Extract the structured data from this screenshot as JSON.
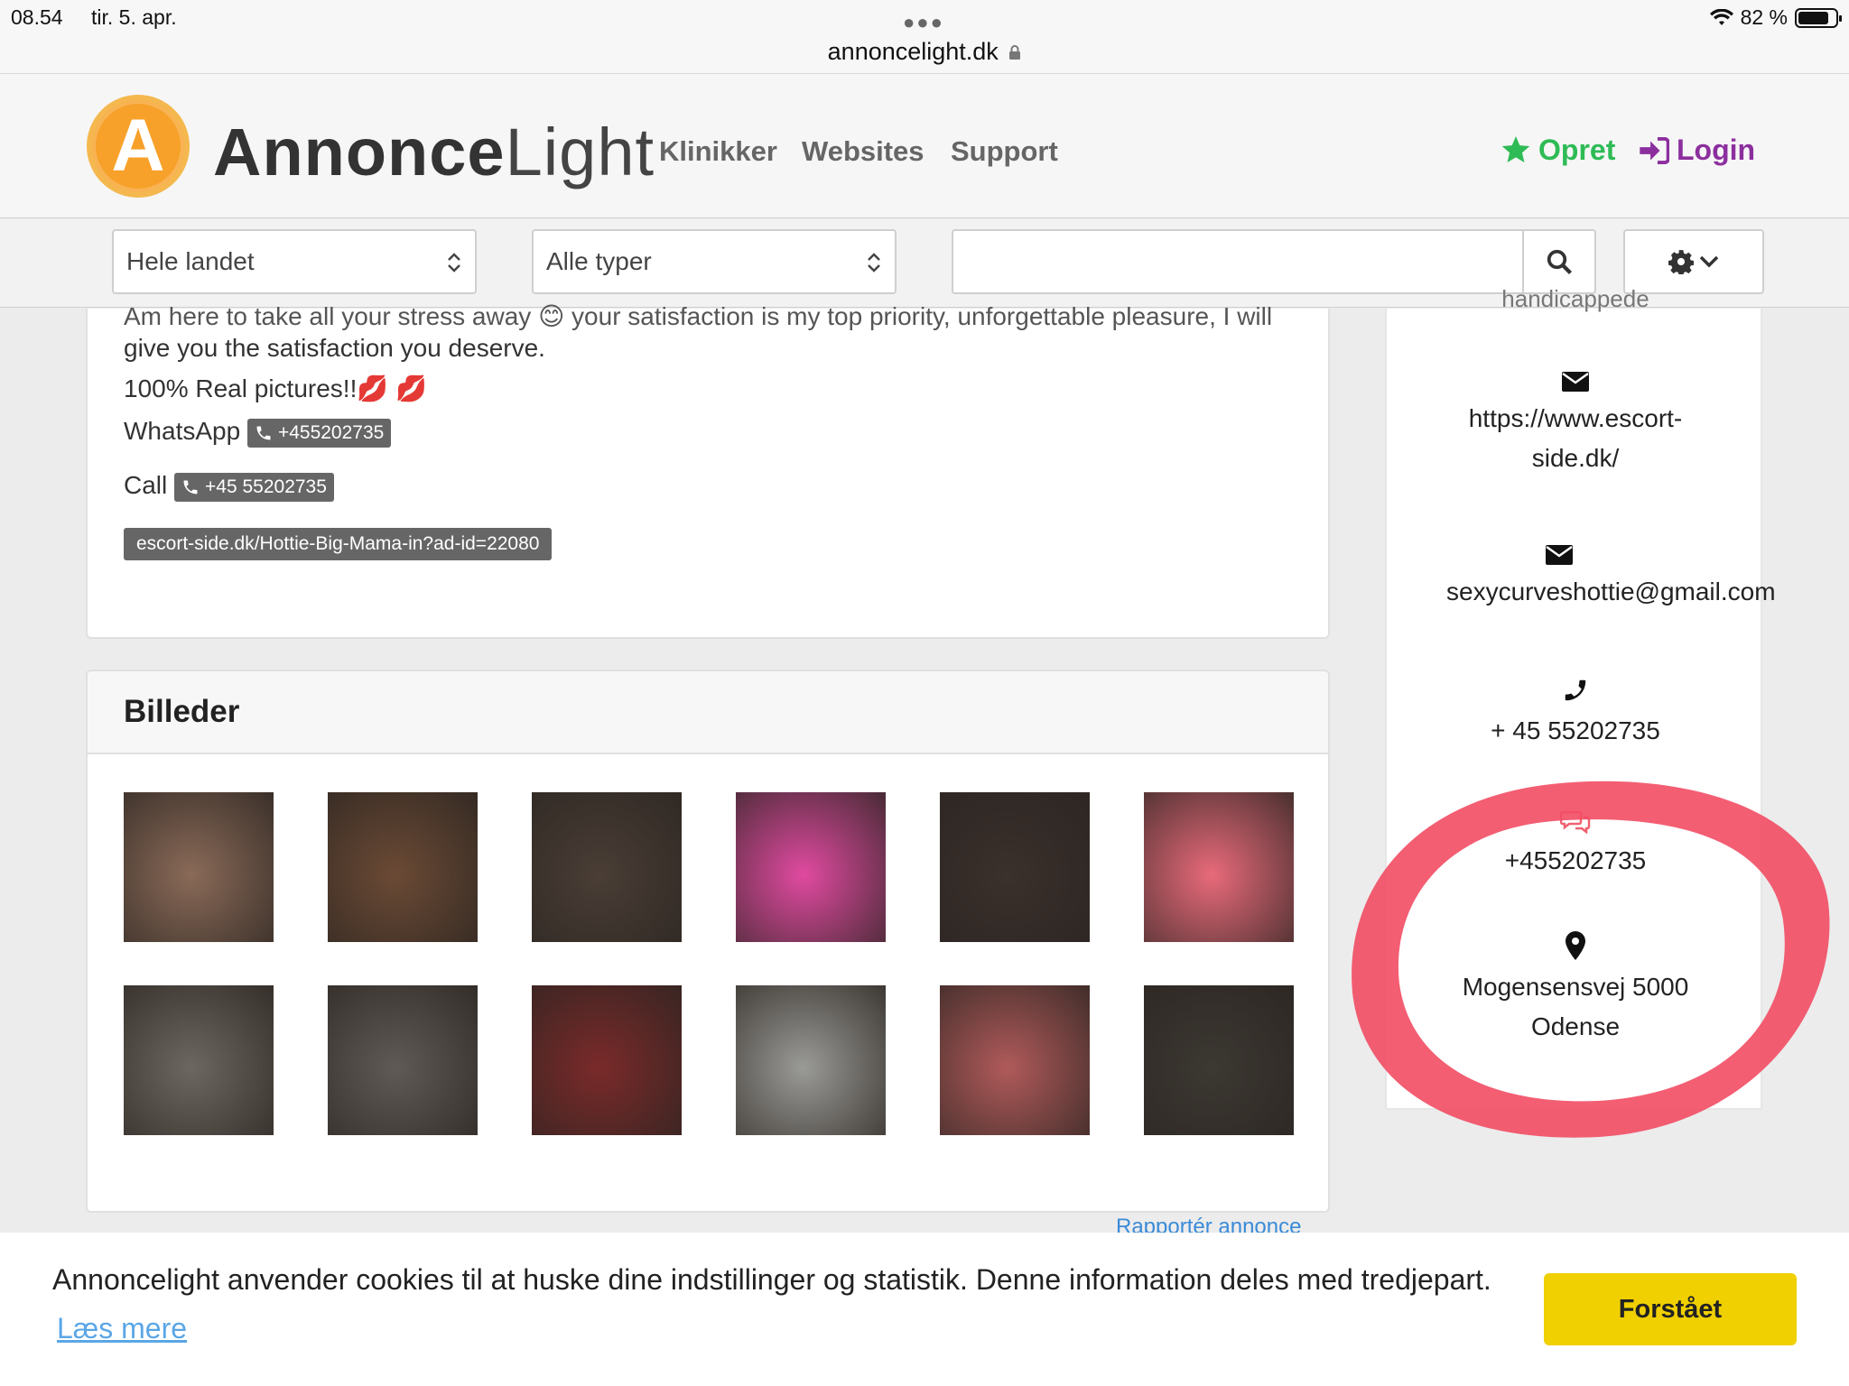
{
  "status_bar": {
    "time": "08.54",
    "date": "tir. 5. apr.",
    "url": "annoncelight.dk",
    "battery": "82 %",
    "battery_level": 0.82
  },
  "header": {
    "logo_letter": "A",
    "brand_part1": "Annonce",
    "brand_part2": "Light",
    "nav": [
      "Klinikker",
      "Websites",
      "Support"
    ],
    "opret_label": "Opret",
    "login_label": "Login",
    "colors": {
      "opret": "#2ebb55",
      "login": "#8c2f9e",
      "logo": "#f7a12a"
    }
  },
  "filters": {
    "region": "Hele landet",
    "type": "Alle typer",
    "search_value": ""
  },
  "description": {
    "cut_line": "Am here to take all your stress away 😊 your satisfaction is my top priority, unforgettable pleasure, I will",
    "line2": "give you the satisfaction you deserve.",
    "line3": "100% Real pictures!!💋 💋",
    "whatsapp_label": "WhatsApp",
    "whatsapp_number": "+455202735",
    "call_label": "Call",
    "call_number": "+45 55202735",
    "url": "escort-side.dk/Hottie-Big-Mama-in?ad-id=22080"
  },
  "gallery": {
    "title": "Billeder",
    "report_link": "Rapportér annonce",
    "thumbs": [
      {
        "color": "#8a6a58"
      },
      {
        "color": "#6b4a35"
      },
      {
        "color": "#4a3e36"
      },
      {
        "color": "#e04aa0"
      },
      {
        "color": "#3a302c"
      },
      {
        "color": "#e86a7a"
      },
      {
        "color": "#6c6760"
      },
      {
        "color": "#5f5a55"
      },
      {
        "color": "#7a2a2a"
      },
      {
        "color": "#9a9a96"
      },
      {
        "color": "#b05a5a"
      },
      {
        "color": "#3c3832"
      }
    ]
  },
  "sidebar": {
    "cut_text": "handicappede",
    "website": "https://www.escort-side.dk/",
    "website_line1": "https://www.escort-",
    "website_line2": "side.dk/",
    "email": "sexycurveshottie@gmail.com",
    "phone": "+ 45 55202735",
    "chat": "+455202735",
    "address_line1": "Mogensensvej 5000",
    "address_line2": "Odense",
    "chat_icon_color": "#f06070",
    "annotation_color": "#f24c64"
  },
  "cookie": {
    "text": "Annoncelight anvender cookies til at huske dine indstillinger og statistik. Denne information deles med tredjepart.",
    "link": "Læs mere",
    "button": "Forstået"
  }
}
